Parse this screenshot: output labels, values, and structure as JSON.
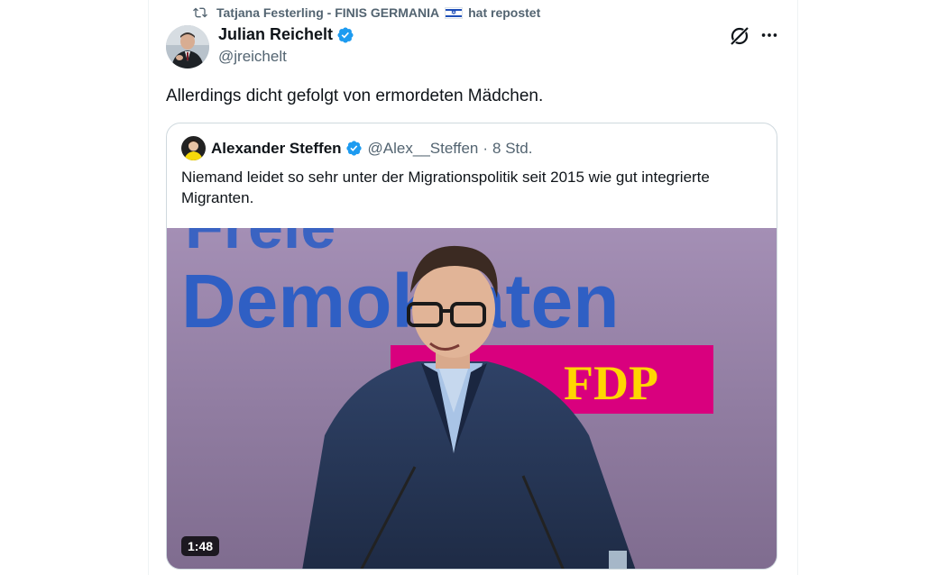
{
  "repost": {
    "user": "Tatjana Festerling - FINIS GERMANIA",
    "suffix": "hat repostet"
  },
  "tweet": {
    "author_name": "Julian Reichelt",
    "author_handle": "@jreichelt",
    "text": "Allerdings dicht gefolgt von ermordeten Mädchen."
  },
  "quote": {
    "author_name": "Alexander Steffen",
    "author_handle": "@Alex__Steffen",
    "separator": "·",
    "time": "8 Std.",
    "text": "Niemand leidet so sehr unter der Migrationspolitik seit 2015 wie gut integrierte Migranten.",
    "media": {
      "banner_line1": "Freie",
      "banner_line2": "Demokraten",
      "party": "FDP",
      "duration": "1:48"
    }
  },
  "colors": {
    "accent": "#1d9bf0",
    "secondary_text": "#536471",
    "fdp_blue": "#2f5fc4",
    "fdp_magenta": "#d9007e",
    "fdp_yellow": "#ffd600"
  },
  "icons": [
    "repost-icon",
    "verified-badge-icon",
    "grok-icon",
    "more-icon"
  ]
}
